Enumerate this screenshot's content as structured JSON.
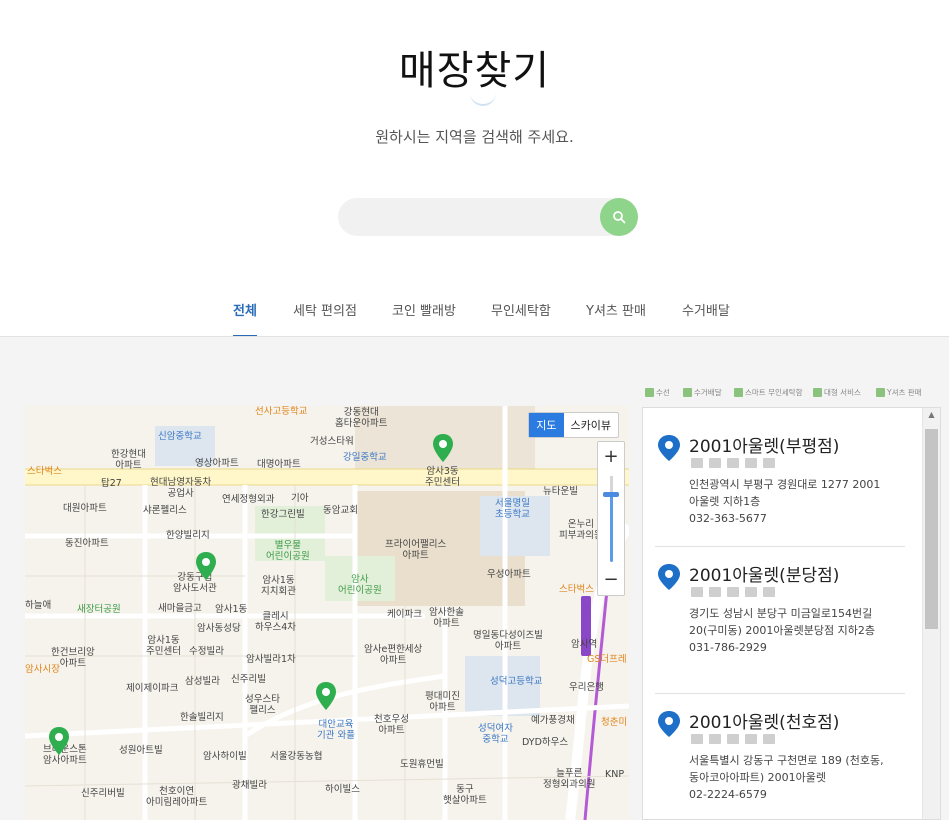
{
  "page": {
    "title": "매장찾기",
    "subtitle": "원하시는 지역을 검색해 주세요."
  },
  "search": {
    "placeholder": "",
    "value": "",
    "icon": "search-icon"
  },
  "tabs": [
    {
      "label": "전체",
      "active": true
    },
    {
      "label": "세탁 편의점",
      "active": false
    },
    {
      "label": "코인 빨래방",
      "active": false
    },
    {
      "label": "무인세탁함",
      "active": false
    },
    {
      "label": "Y셔츠 판매",
      "active": false
    },
    {
      "label": "수거배달",
      "active": false
    }
  ],
  "map": {
    "type_buttons": {
      "map": "지도",
      "skyview": "스카이뷰"
    },
    "zoom_in": "+",
    "zoom_out": "−",
    "labels": [
      {
        "text": "선사고등학교",
        "color": "orange"
      },
      {
        "text": "강동현대\n홈타운아파트",
        "color": "dark"
      },
      {
        "text": "신암중학교",
        "color": "blue"
      },
      {
        "text": "거성스타워",
        "color": "dark"
      },
      {
        "text": "강일중학교",
        "color": "blue"
      },
      {
        "text": "한강현대\n아파트",
        "color": "dark"
      },
      {
        "text": "영상아파트",
        "color": "dark"
      },
      {
        "text": "대명아파트",
        "color": "dark"
      },
      {
        "text": "스타벅스",
        "color": "orange"
      },
      {
        "text": "탑27",
        "color": "dark"
      },
      {
        "text": "현대남영자동차\n공업사",
        "color": "dark"
      },
      {
        "text": "암사3동\n주민센터",
        "color": "dark"
      },
      {
        "text": "대원아파트",
        "color": "dark"
      },
      {
        "text": "샤론펠리스",
        "color": "dark"
      },
      {
        "text": "연세정형외과",
        "color": "dark"
      },
      {
        "text": "기아",
        "color": "dark"
      },
      {
        "text": "동암교회",
        "color": "dark"
      },
      {
        "text": "한강그린빌",
        "color": "dark"
      },
      {
        "text": "서울명일\n초등학교",
        "color": "blue"
      },
      {
        "text": "뉴타운빌",
        "color": "dark"
      },
      {
        "text": "동진아파트",
        "color": "dark"
      },
      {
        "text": "한양빌리지",
        "color": "dark"
      },
      {
        "text": "별우물\n어린이공원",
        "color": "green"
      },
      {
        "text": "프라이어팰리스\n아파트",
        "color": "dark"
      },
      {
        "text": "온누리\n피부과의원",
        "color": "dark"
      },
      {
        "text": "강동구립\n암사도서관",
        "color": "dark"
      },
      {
        "text": "암사1동\n지치회관",
        "color": "dark"
      },
      {
        "text": "암사\n어린이공원",
        "color": "green"
      },
      {
        "text": "우성아파트",
        "color": "dark"
      },
      {
        "text": "스타벅스",
        "color": "orange"
      },
      {
        "text": "하늘애",
        "color": "dark"
      },
      {
        "text": "새장터공원",
        "color": "green"
      },
      {
        "text": "새마을금고",
        "color": "dark"
      },
      {
        "text": "암사1동",
        "color": "dark"
      },
      {
        "text": "클레시\n하우스4차",
        "color": "dark"
      },
      {
        "text": "케이파크",
        "color": "dark"
      },
      {
        "text": "암사한솔\n아파트",
        "color": "dark"
      },
      {
        "text": "암사1동\n주민센터",
        "color": "dark"
      },
      {
        "text": "암사동성당",
        "color": "dark"
      },
      {
        "text": "암사e편한세상\n아파트",
        "color": "dark"
      },
      {
        "text": "명일동다성이즈빌\n아파트",
        "color": "dark"
      },
      {
        "text": "한건브리앙\n아파트",
        "color": "dark"
      },
      {
        "text": "수정빌라",
        "color": "dark"
      },
      {
        "text": "암사빌라1차",
        "color": "dark"
      },
      {
        "text": "GS더프레",
        "color": "orange"
      },
      {
        "text": "제이제이파크",
        "color": "dark"
      },
      {
        "text": "삼성빌라",
        "color": "dark"
      },
      {
        "text": "신주리빌",
        "color": "dark"
      },
      {
        "text": "성덕고등학교",
        "color": "blue"
      },
      {
        "text": "우리은행",
        "color": "dark"
      },
      {
        "text": "성우스타\n팰리스",
        "color": "dark"
      },
      {
        "text": "평대미진\n아파트",
        "color": "dark"
      },
      {
        "text": "한솔빌리지",
        "color": "dark"
      },
      {
        "text": "대안교육\n기관 와플",
        "color": "blue"
      },
      {
        "text": "천호우성\n아파트",
        "color": "dark"
      },
      {
        "text": "성덕여자\n중학교",
        "color": "blue"
      },
      {
        "text": "예가풍경채",
        "color": "dark"
      },
      {
        "text": "청춘미",
        "color": "orange"
      },
      {
        "text": "브라운스톤\n암사아파트",
        "color": "dark"
      },
      {
        "text": "성원아트빌",
        "color": "dark"
      },
      {
        "text": "암사하이빌",
        "color": "dark"
      },
      {
        "text": "서울강동농협",
        "color": "dark"
      },
      {
        "text": "DYD하우스",
        "color": "dark"
      },
      {
        "text": "광채빌라",
        "color": "dark"
      },
      {
        "text": "도원휴먼빌",
        "color": "dark"
      },
      {
        "text": "늘푸른\n정형외과의원",
        "color": "dark"
      },
      {
        "text": "KNP",
        "color": "dark"
      },
      {
        "text": "신주리버빌",
        "color": "dark"
      },
      {
        "text": "천호이연\n아미림레아파트",
        "color": "dark"
      },
      {
        "text": "하이빌스",
        "color": "dark"
      },
      {
        "text": "동구\n햇살아파트",
        "color": "dark"
      },
      {
        "text": "암사시장",
        "color": "orange"
      },
      {
        "text": "암사역",
        "color": "dark"
      }
    ]
  },
  "legend": [
    {
      "label": "수선",
      "icon": "scissors-icon"
    },
    {
      "label": "수거배달",
      "icon": "truck-icon"
    },
    {
      "label": "스마트 무인세탁함",
      "icon": "locker-icon"
    },
    {
      "label": "대형 서비스",
      "icon": "building-icon"
    },
    {
      "label": "Y셔츠 판매",
      "icon": "shirt-icon"
    }
  ],
  "stores": [
    {
      "name": "2001아울렛(부평점)",
      "address": "인천광역시 부평구 경원대로 1277 2001아울렛 지하1층",
      "phone": "032-363-5677"
    },
    {
      "name": "2001아울렛(분당점)",
      "address": "경기도 성남시 분당구 미금일로154번길 20(구미동) 2001아울렛분당점 지하2층",
      "phone": "031-786-2929"
    },
    {
      "name": "2001아울렛(천호점)",
      "address": "서울특별시 강동구 구천면로 189 (천호동, 동아코아아파트) 2001아울렛",
      "phone": "02-2224-6579"
    }
  ],
  "colors": {
    "accent": "#2a6bb8",
    "search_button": "#8ed48a",
    "marker": "#2fae4f",
    "store_pin": "#1e6fc8"
  }
}
